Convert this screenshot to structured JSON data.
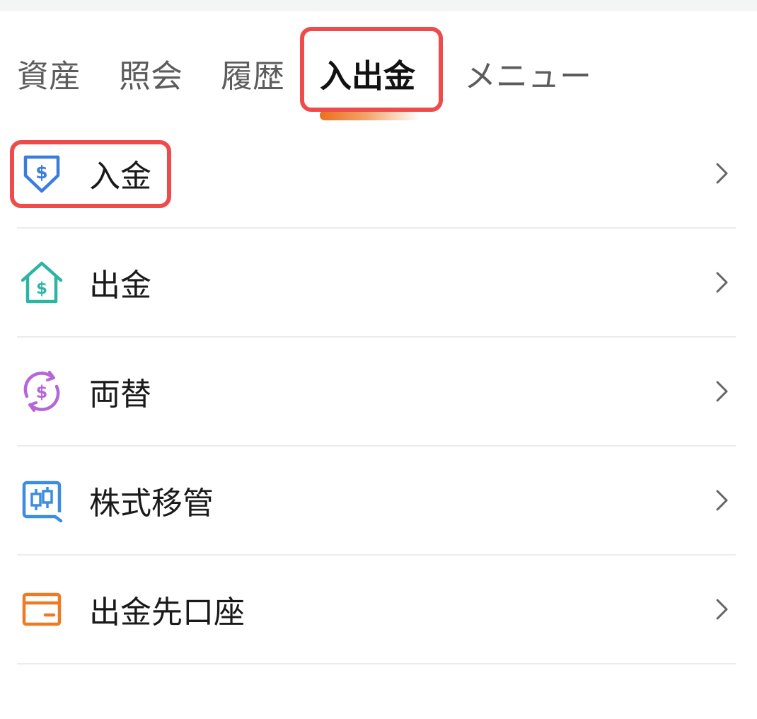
{
  "tabs": [
    {
      "label": "資産"
    },
    {
      "label": "照会"
    },
    {
      "label": "履歴"
    },
    {
      "label": "入出金"
    },
    {
      "label": "メニュー"
    }
  ],
  "active_tab": "入出金",
  "menu": {
    "items": [
      {
        "label": "入金",
        "icon": "deposit-icon",
        "color": "#3b7ddd"
      },
      {
        "label": "出金",
        "icon": "withdraw-icon",
        "color": "#2bb5a5"
      },
      {
        "label": "両替",
        "icon": "exchange-icon",
        "color": "#b565d9"
      },
      {
        "label": "株式移管",
        "icon": "stock-transfer-icon",
        "color": "#3b8de0"
      },
      {
        "label": "出金先口座",
        "icon": "withdrawal-account-icon",
        "color": "#ee7a23"
      }
    ]
  },
  "colors": {
    "highlight": "#f04b4b",
    "active_underline": "#ec6f1f"
  }
}
